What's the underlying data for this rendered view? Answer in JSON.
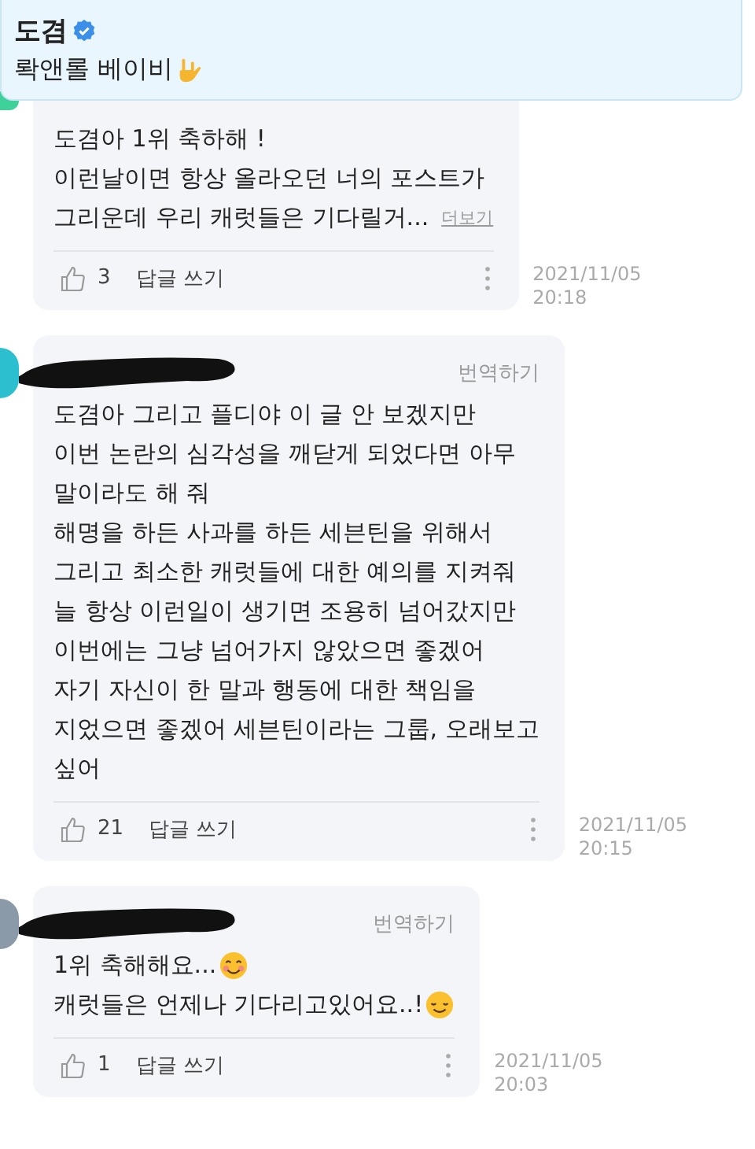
{
  "pinned": {
    "author": "도겸",
    "verified": true,
    "lines": [
      {
        "kind": "rock-hand",
        "text": "롹앤롤 베이비"
      }
    ]
  },
  "comments": [
    {
      "color": "#3ed19a",
      "lines": [
        {
          "kind": "plain",
          "text": "도겸아 1위 축하해 !"
        },
        {
          "kind": "plain",
          "text": "이런날이면 항상 올라오던 너의 포스트가"
        },
        {
          "kind": "plain",
          "text": "그리운데 우리 캐럿들은 기다릴거..."
        }
      ],
      "more": "더보기",
      "likes": "3",
      "reply": "답글 쓰기",
      "date": "2021/11/05",
      "time": "20:18"
    },
    {
      "color": "#2bbfd0",
      "redacted": true,
      "translate": "번역하기",
      "lines": [
        {
          "kind": "plain",
          "text": "도겸아 그리고 플디야 이 글 안 보겠지만"
        },
        {
          "kind": "plain",
          "text": "이번 논란의 심각성을 깨닫게 되었다면 아무"
        },
        {
          "kind": "plain",
          "text": "말이라도 해 줘"
        },
        {
          "kind": "plain",
          "text": "해명을 하든 사과를 하든 세븐틴을 위해서"
        },
        {
          "kind": "plain",
          "text": "그리고 최소한 캐럿들에 대한 예의를 지켜줘"
        },
        {
          "kind": "plain",
          "text": "늘 항상 이런일이 생기면 조용히 넘어갔지만"
        },
        {
          "kind": "plain",
          "text": "이번에는 그냥 넘어가지 않았으면 좋겠어"
        },
        {
          "kind": "plain",
          "text": "자기 자신이 한 말과 행동에 대한 책임을"
        },
        {
          "kind": "plain",
          "text": "지었으면 좋겠어 세븐틴이라는 그룹, 오래보고"
        },
        {
          "kind": "plain",
          "text": "싶어"
        }
      ],
      "likes": "21",
      "reply": "답글 쓰기",
      "date": "2021/11/05",
      "time": "20:15"
    },
    {
      "color": "#8a9aa8",
      "redacted": true,
      "translate": "번역하기",
      "lines": [
        {
          "kind": "smiling",
          "text": "1위 축해해요..."
        },
        {
          "kind": "relieved",
          "text": "캐럿들은 언제나 기다리고있어요..!"
        }
      ],
      "likes": "1",
      "reply": "답글 쓰기",
      "date": "2021/11/05",
      "time": "20:03"
    }
  ]
}
